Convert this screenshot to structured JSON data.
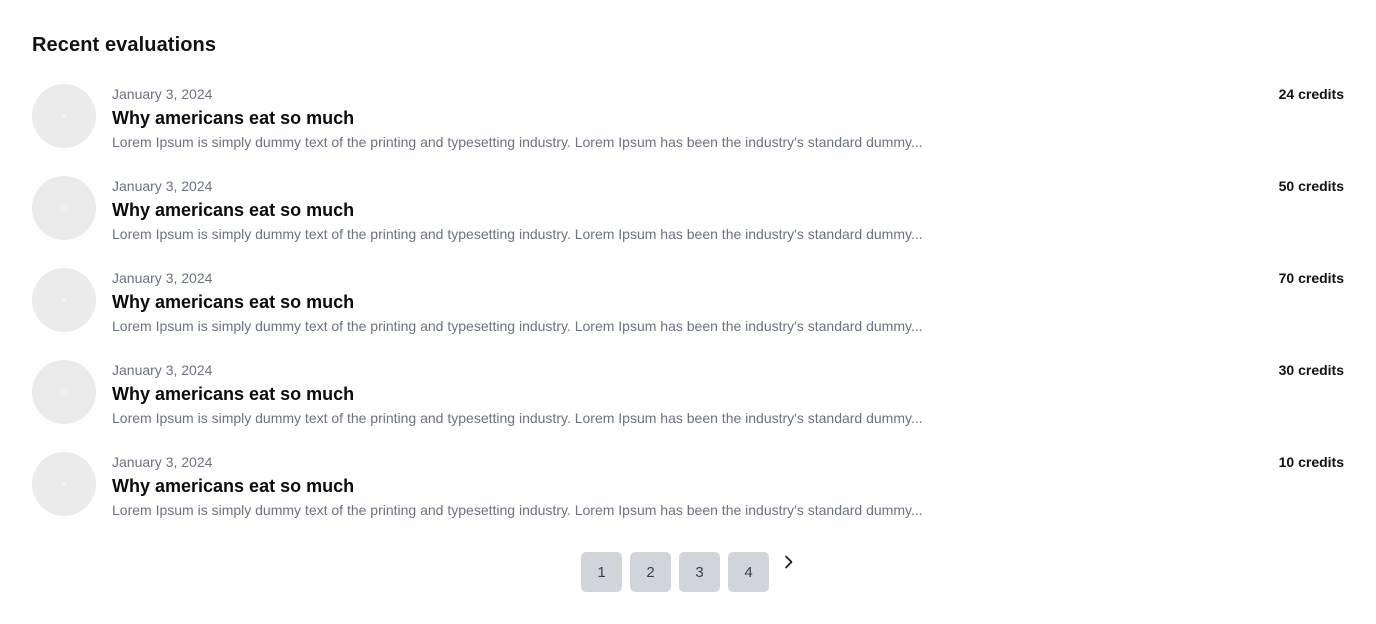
{
  "section": {
    "title": "Recent evaluations"
  },
  "evaluations": [
    {
      "date": "January 3, 2024",
      "title": "Why americans eat so much",
      "description": "Lorem Ipsum is simply dummy text of the printing and typesetting industry. Lorem Ipsum has been the industry's standard dummy...",
      "credits": "24 credits"
    },
    {
      "date": "January 3, 2024",
      "title": "Why americans eat so much",
      "description": "Lorem Ipsum is simply dummy text of the printing and typesetting industry. Lorem Ipsum has been the industry's standard dummy...",
      "credits": "50 credits"
    },
    {
      "date": "January 3, 2024",
      "title": "Why americans eat so much",
      "description": "Lorem Ipsum is simply dummy text of the printing and typesetting industry. Lorem Ipsum has been the industry's standard dummy...",
      "credits": "70 credits"
    },
    {
      "date": "January 3, 2024",
      "title": "Why americans eat so much",
      "description": "Lorem Ipsum is simply dummy text of the printing and typesetting industry. Lorem Ipsum has been the industry's standard dummy...",
      "credits": "30 credits"
    },
    {
      "date": "January 3, 2024",
      "title": "Why americans eat so much",
      "description": "Lorem Ipsum is simply dummy text of the printing and typesetting industry. Lorem Ipsum has been the industry's standard dummy...",
      "credits": "10 credits"
    }
  ],
  "pagination": {
    "pages": [
      "1",
      "2",
      "3",
      "4"
    ],
    "next_icon": "chevron-right-icon"
  },
  "colors": {
    "thumb_bg": "#ebebeb",
    "muted_text": "#6b7280",
    "page_button_bg": "#d1d5db"
  }
}
